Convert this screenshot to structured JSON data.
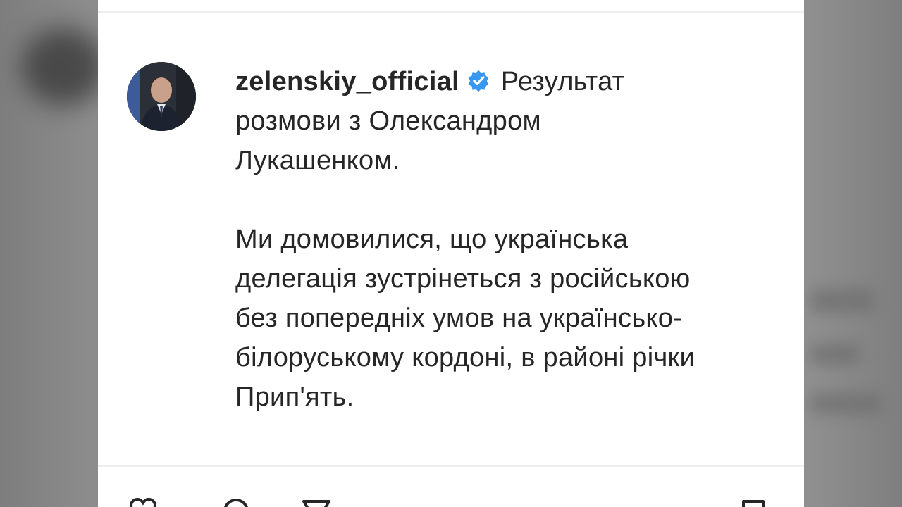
{
  "post": {
    "username": "zelenskiy_official",
    "verified_icon": "verified-badge-icon",
    "caption_lines_1": [
      "Результат",
      "розмови з Олександром",
      "Лукашенком."
    ],
    "caption_lines_2": [
      "Ми домовилися, що українська",
      "делегація зустрінеться з російською",
      "без попередніх умов на українсько-",
      "білоруському кордоні, в районі річки",
      "Прип'ять."
    ]
  },
  "actions": {
    "icons": [
      "heart-icon",
      "comment-icon",
      "share-icon",
      "bookmark-icon"
    ]
  },
  "colors": {
    "text": "#262626",
    "verified": "#3897f0",
    "panel": "#ffffff"
  }
}
